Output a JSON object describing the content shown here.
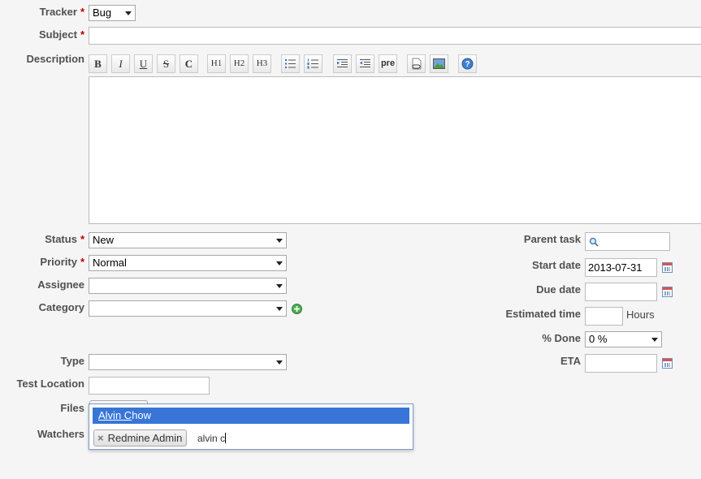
{
  "form": {
    "tracker": {
      "label": "Tracker",
      "value": "Bug"
    },
    "subject": {
      "label": "Subject",
      "value": ""
    },
    "description": {
      "label": "Description"
    },
    "status": {
      "label": "Status",
      "value": "New"
    },
    "priority": {
      "label": "Priority",
      "value": "Normal"
    },
    "assignee": {
      "label": "Assignee",
      "value": ""
    },
    "category": {
      "label": "Category",
      "value": ""
    },
    "type": {
      "label": "Type",
      "value": ""
    },
    "test_location": {
      "label": "Test Location",
      "value": ""
    },
    "files": {
      "label": "Files"
    },
    "watchers": {
      "label": "Watchers"
    },
    "parent_task": {
      "label": "Parent task"
    },
    "start_date": {
      "label": "Start date",
      "value": "2013-07-31"
    },
    "due_date": {
      "label": "Due date",
      "value": ""
    },
    "estimated_time": {
      "label": "Estimated time",
      "unit": "Hours",
      "value": ""
    },
    "percent_done": {
      "label": "% Done",
      "value": "0 %"
    },
    "eta": {
      "label": "ETA",
      "value": ""
    },
    "required_marker": "*"
  },
  "toolbar": {
    "bold": "B",
    "italic": "I",
    "underline": "U",
    "strike": "S",
    "code": "C",
    "h1": "H1",
    "h2": "H2",
    "h3": "H3",
    "pre": "pre"
  },
  "watchers_widget": {
    "suggestion_match": "Alvin C",
    "suggestion_rest": "how",
    "chip_label": "Redmine Admin",
    "chip_remove": "×",
    "typed_text": "alvin c"
  },
  "colors": {
    "accent": "#3875d7",
    "required": "#bb0000",
    "label": "#505050"
  }
}
